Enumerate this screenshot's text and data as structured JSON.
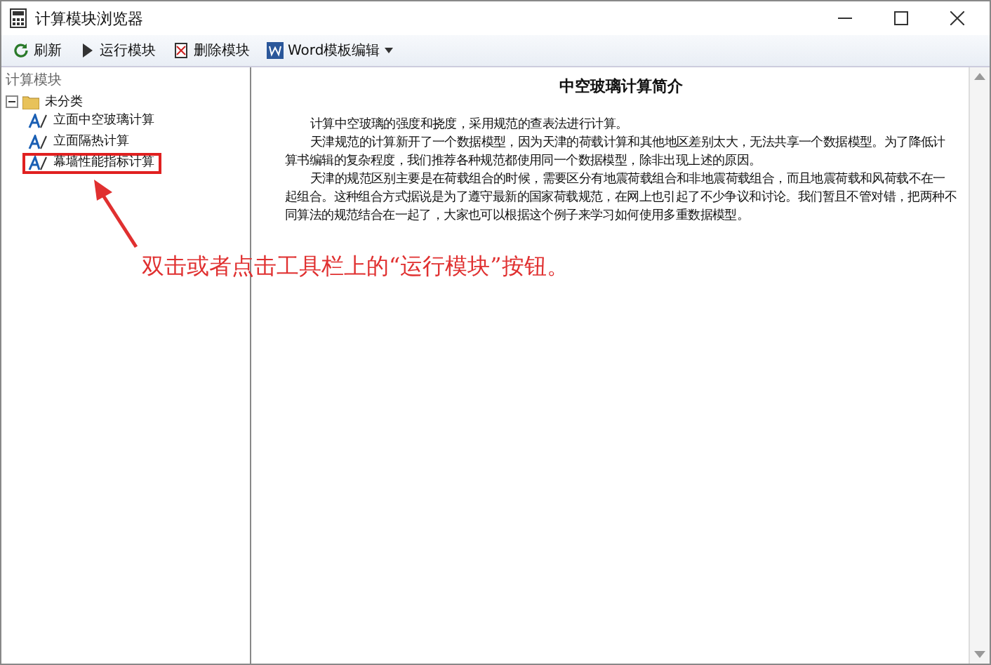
{
  "window": {
    "title": "计算模块浏览器"
  },
  "toolbar": [
    {
      "kind": "refresh",
      "label": "刷新"
    },
    {
      "kind": "run",
      "label": "运行模块"
    },
    {
      "kind": "delete",
      "label": "删除模块"
    },
    {
      "kind": "word",
      "label": "Word模板编辑",
      "dropdown": true
    }
  ],
  "sidebar": {
    "label": "计算模块",
    "tree": [
      {
        "label": "未分类",
        "expanded": true,
        "children": [
          {
            "label": "立面中空玻璃计算",
            "selected": false
          },
          {
            "label": "立面隔热计算",
            "selected": false
          },
          {
            "label": "幕墙性能指标计算",
            "selected": false,
            "highlighted": true
          }
        ]
      }
    ]
  },
  "document": {
    "title": "中空玻璃计算简介",
    "paragraphs": [
      "计算中空玻璃的强度和挠度，采用规范的查表法进行计算。",
      "天津规范的计算新开了一个数据模型，因为天津的荷载计算和其他地区差别太大，无法共享一个数据模型。为了降低计算书编辑的复杂程度，我们推荐各种规范都使用同一个数据模型，除非出现上述的原因。",
      "天津的规范区别主要是在荷载组合的时候，需要区分有地震荷载组合和非地震荷载组合，而且地震荷载和风荷载不在一起组合。这种组合方式据说是为了遵守最新的国家荷载规范，在网上也引起了不少争议和讨论。我们暂且不管对错，把两种不同算法的规范结合在一起了，大家也可以根据这个例子来学习如何使用多重数据模型。"
    ]
  },
  "annotation": {
    "text": "双击或者点击工具栏上的“运行模块”按钮。"
  }
}
